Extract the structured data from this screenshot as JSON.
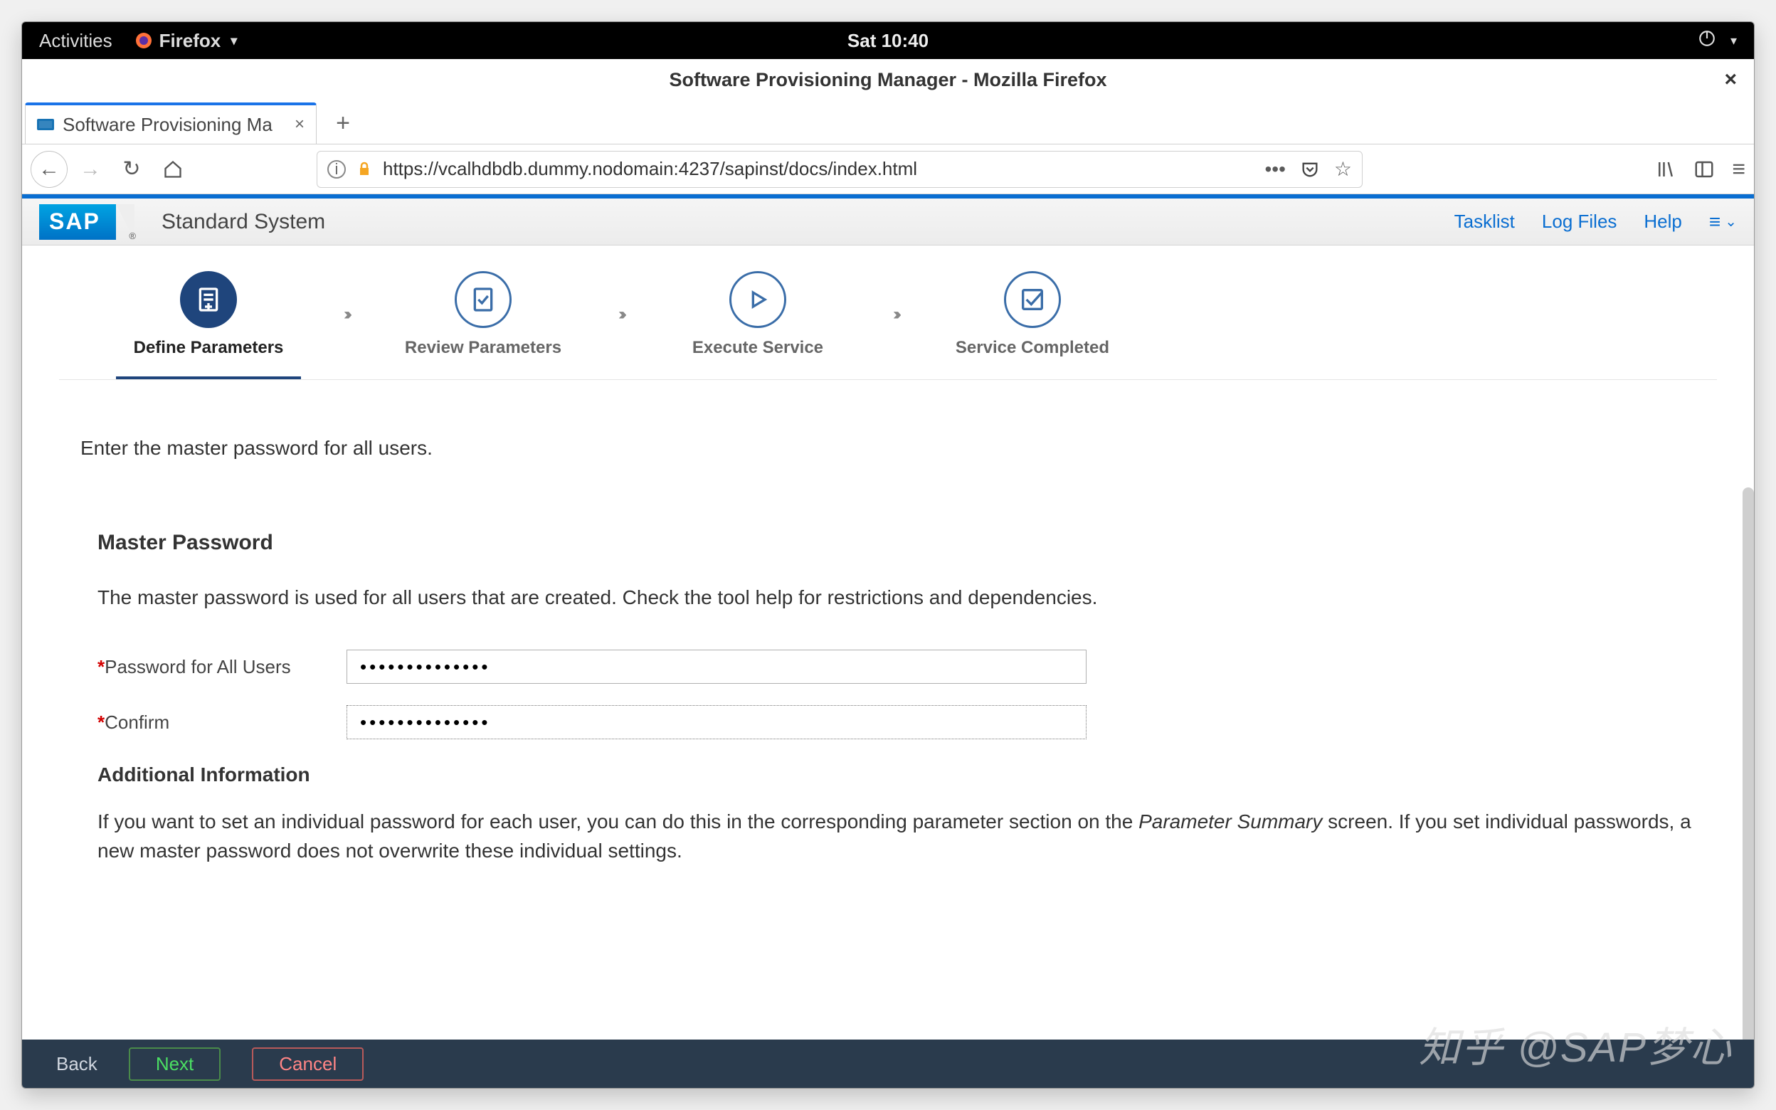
{
  "gnome": {
    "activities": "Activities",
    "app_name": "Firefox",
    "clock": "Sat 10:40"
  },
  "firefox": {
    "window_title": "Software Provisioning Manager - Mozilla Firefox",
    "tab_title": "Software Provisioning Ma",
    "url": "https://vcalhdbdb.dummy.nodomain:4237/sapinst/docs/index.html"
  },
  "sap": {
    "product_title": "Standard System",
    "links": {
      "tasklist": "Tasklist",
      "logfiles": "Log Files",
      "help": "Help"
    },
    "wizard": {
      "step1": "Define Parameters",
      "step2": "Review Parameters",
      "step3": "Execute Service",
      "step4": "Service Completed"
    },
    "form": {
      "lead": "Enter the master password for all users.",
      "section_title": "Master Password",
      "section_desc": "The master password is used for all users that are created. Check the tool help for restrictions and dependencies.",
      "label_password": "Password for All Users",
      "label_confirm": "Confirm",
      "password_value": "••••••••••••••",
      "confirm_value": "••••••••••••••",
      "addl_title": "Additional Information",
      "addl_text_1": "If you want to set an individual password for each user, you can do this in the corresponding parameter section on the ",
      "addl_em": "Parameter Summary",
      "addl_text_2": " screen. If you set individual passwords, a new master password does not overwrite these individual settings."
    },
    "footer": {
      "back": "Back",
      "next": "Next",
      "cancel": "Cancel"
    }
  },
  "watermark": "知乎 @SAP梦心"
}
